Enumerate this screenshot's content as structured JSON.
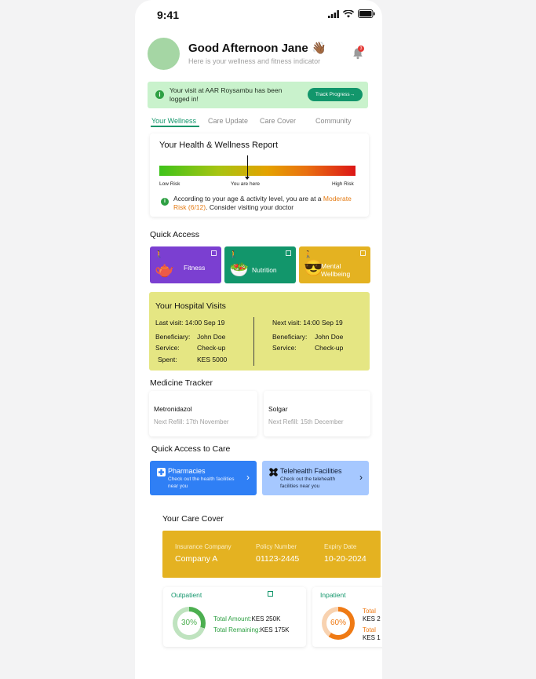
{
  "status": {
    "time": "9:41"
  },
  "greeting": {
    "title": "Good Afternoon Jane 👋🏾",
    "subtitle": "Here is your wellness and fitness indicator",
    "notification_count": "3"
  },
  "notice": {
    "message": "Your visit at AAR Roysambu has been logged in!",
    "button": "Track Progress→"
  },
  "tabs": [
    "Your Wellness",
    "Care Update",
    "Care Cover",
    "Community"
  ],
  "wellness": {
    "title": "Your Health & Wellness Report",
    "low_label": "Low Risk",
    "here_label": "You are here",
    "high_label": "High Risk",
    "desc_prefix": "According to your age & activity level, you are at a ",
    "risk_text": "Moderate Risk (6/12)",
    "desc_suffix": ". Consider visiting your doctor",
    "risk_score": 6,
    "risk_max": 12
  },
  "quick_access": {
    "title": "Quick Access",
    "tiles": [
      {
        "label": "Fitness",
        "emoji": "🫖",
        "color": "#7b3fd1"
      },
      {
        "label": "Nutrition",
        "emoji": "🥗",
        "color": "#12966b"
      },
      {
        "label": "Mental Wellbeing",
        "line1": "Mental",
        "line2": "Wellbeing",
        "emoji": "😎",
        "color": "#e4b221"
      }
    ]
  },
  "hospital": {
    "title": "Your Hospital Visits",
    "last_visit": "Last visit: 14:00 Sep 19",
    "next_visit": "Next visit: 14:00 Sep 19",
    "left": {
      "beneficiary_label": "Beneficiary:",
      "beneficiary": "John Doe",
      "service_label": "Service:",
      "service": "Check-up",
      "spent_label": "Spent:",
      "spent": "KES 5000"
    },
    "right": {
      "beneficiary_label": "Beneficiary:",
      "beneficiary": "John Doe",
      "service_label": "Service:",
      "service": "Check-up"
    }
  },
  "medicine": {
    "title": "Medicine Tracker",
    "items": [
      {
        "name": "Metronidazol",
        "refill": "Next Refill: 17th November"
      },
      {
        "name": "Solgar",
        "refill": "Next Refill: 15th December"
      }
    ]
  },
  "care_access": {
    "title": "Quick Access to Care",
    "tiles": [
      {
        "title": "Pharmacies",
        "subtitle_1": "Check out the health facilities",
        "subtitle_2": "near you",
        "color": "#2f7ff5"
      },
      {
        "title": "Telehealth Facilities",
        "subtitle_1": "Check out the telehealth",
        "subtitle_2": "facilities near you",
        "color": "#a6c8ff"
      }
    ]
  },
  "care_cover": {
    "title": "Your Care Cover",
    "insurance_label": "Insurance Company",
    "insurance": "Company A",
    "policy_label": "Policy Number",
    "policy": "01123-2445",
    "expiry_label": "Expiry Date",
    "expiry": "10-20-2024",
    "outpatient": {
      "title": "Outpatient",
      "percent_text": "30%",
      "percent": 30,
      "amount_label": "Total Amount:",
      "amount": "KES 250K",
      "remaining_label": "Total Remaining:",
      "remaining": "KES 175K",
      "color": "#4caf50"
    },
    "inpatient": {
      "title": "Inpatient",
      "percent_text": "60%",
      "percent": 60,
      "amount_label": "Total",
      "amount": "KES 2",
      "remaining_label": "Total",
      "remaining": "KES 1",
      "color": "#ef7a14"
    }
  }
}
